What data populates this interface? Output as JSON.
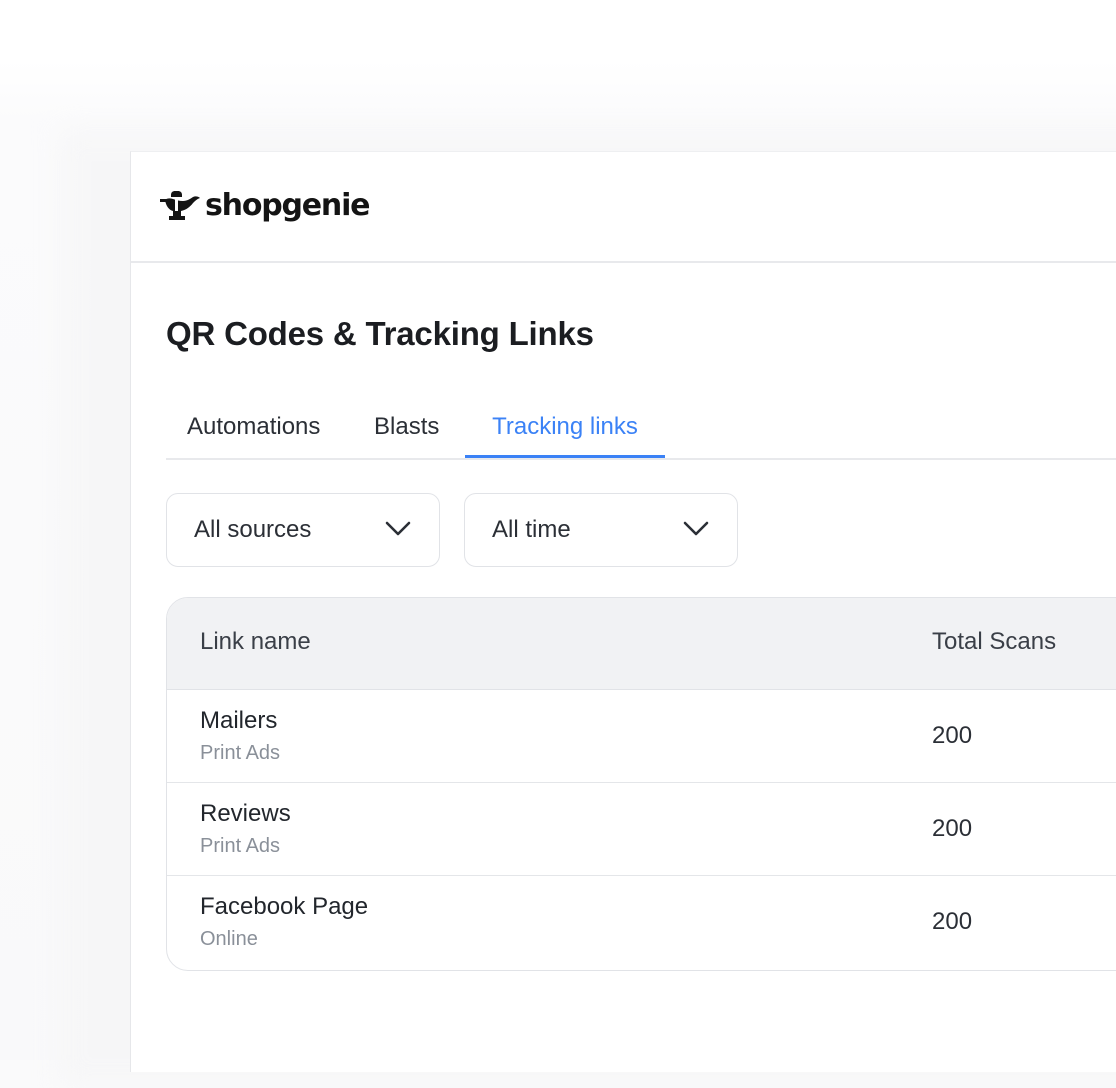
{
  "brand": {
    "name": "shopgenie",
    "logo_icon": "genie-lamp-icon"
  },
  "page": {
    "title": "QR Codes & Tracking Links"
  },
  "tabs": [
    {
      "label": "Automations",
      "active": false
    },
    {
      "label": "Blasts",
      "active": false
    },
    {
      "label": "Tracking links",
      "active": true
    }
  ],
  "filters": {
    "source": {
      "value": "All sources",
      "icon": "chevron-down-icon"
    },
    "time": {
      "value": "All time",
      "icon": "chevron-down-icon"
    }
  },
  "table": {
    "columns": [
      "Link name",
      "Total Scans"
    ],
    "rows": [
      {
        "name": "Mailers",
        "source": "Print Ads",
        "scans": "200"
      },
      {
        "name": "Reviews",
        "source": "Print Ads",
        "scans": "200"
      },
      {
        "name": "Facebook Page",
        "source": "Online",
        "scans": "200"
      }
    ]
  },
  "colors": {
    "accent": "#3b82f6",
    "header_bg": "#f1f2f4",
    "muted_text": "#8a9099"
  }
}
